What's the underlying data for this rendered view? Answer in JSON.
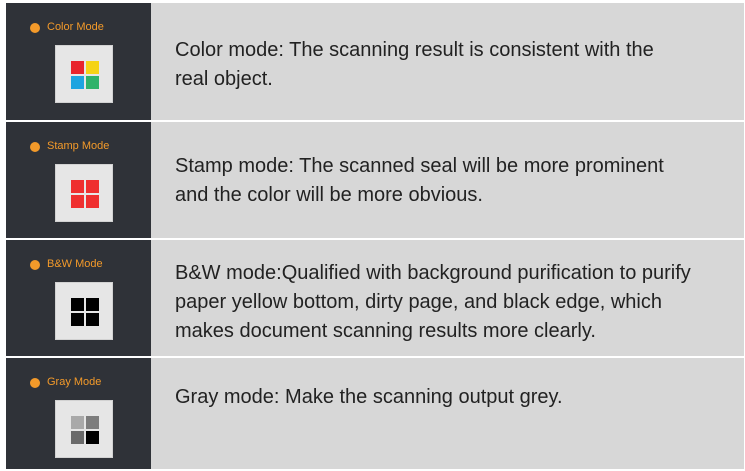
{
  "modes": [
    {
      "label": "Color Mode",
      "label_color": "#f39a2a",
      "icon": "color-mode-icon",
      "squares": [
        "#e8242c",
        "#f5d316",
        "#1ea4e0",
        "#2fb36a"
      ],
      "description": "Color mode: The scanning result is consistent with the\n real object."
    },
    {
      "label": "Stamp Mode",
      "label_color": "#f39a2a",
      "icon": "stamp-mode-icon",
      "squares": [
        "#ef2f2f",
        "#ef2f2f",
        "#ef2f2f",
        "#ef2f2f"
      ],
      "description": "Stamp mode: The scanned seal will be more prominent\nand the color will be more obvious."
    },
    {
      "label": "B&W Mode",
      "label_color": "#f39a2a",
      "icon": "bw-mode-icon",
      "squares": [
        "#000000",
        "#000000",
        "#000000",
        "#000000"
      ],
      "description": "B&W mode:Qualified with background purification to purify\npaper yellow bottom, dirty page, and black edge, which\nmakes document scanning results more clearly."
    },
    {
      "label": "Gray Mode",
      "label_color": "#f39a2a",
      "icon": "gray-mode-icon",
      "squares": [
        "#a9a9a9",
        "#7d7d7d",
        "#6a6a6a",
        "#000000"
      ],
      "description": "Gray mode: Make the scanning output grey."
    }
  ],
  "colors": {
    "sidebar_bg": "#2f3238",
    "desc_bg": "#d7d7d7",
    "accent_dot": "#f39a2a"
  }
}
